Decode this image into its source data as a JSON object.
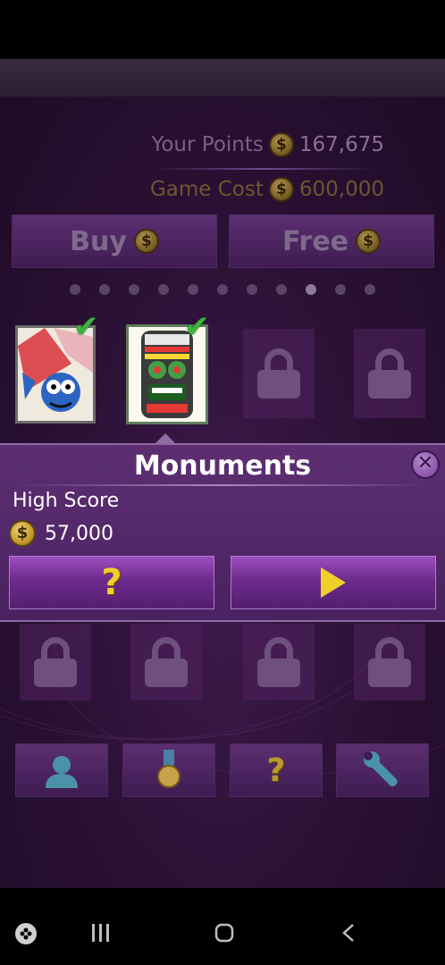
{
  "points": {
    "your_points_label": "Your Points",
    "your_points_value": "167,675",
    "game_cost_label": "Game Cost",
    "game_cost_value": "600,000",
    "coin_symbol": "$"
  },
  "top_buttons": {
    "buy_label": "Buy",
    "free_label": "Free"
  },
  "pager": {
    "total_pages": 11,
    "current_page": 9
  },
  "tiles_row1": [
    {
      "kind": "game",
      "name": "fish-game-thumbnail",
      "completed": true
    },
    {
      "kind": "game",
      "name": "monuments-thumbnail",
      "completed": true,
      "selected": true
    },
    {
      "kind": "locked"
    },
    {
      "kind": "locked"
    }
  ],
  "popup": {
    "title": "Monuments",
    "high_score_label": "High Score",
    "high_score_value": "57,000",
    "help_icon": "question-mark-icon",
    "play_icon": "play-icon",
    "close_icon": "close-icon"
  },
  "tiles_row2": [
    {
      "kind": "locked"
    },
    {
      "kind": "locked"
    },
    {
      "kind": "locked"
    },
    {
      "kind": "locked"
    }
  ],
  "bottom_bar": {
    "icons": [
      "profile-icon",
      "medal-icon",
      "help-icon",
      "wrench-icon"
    ]
  },
  "nav": {
    "icons": [
      "game-launcher-icon",
      "recent-apps-icon",
      "home-icon",
      "back-icon"
    ]
  },
  "colors": {
    "accent_gold": "#f1cf2a",
    "check_green": "#3db33d",
    "panel_purple": "#5d2f72"
  }
}
